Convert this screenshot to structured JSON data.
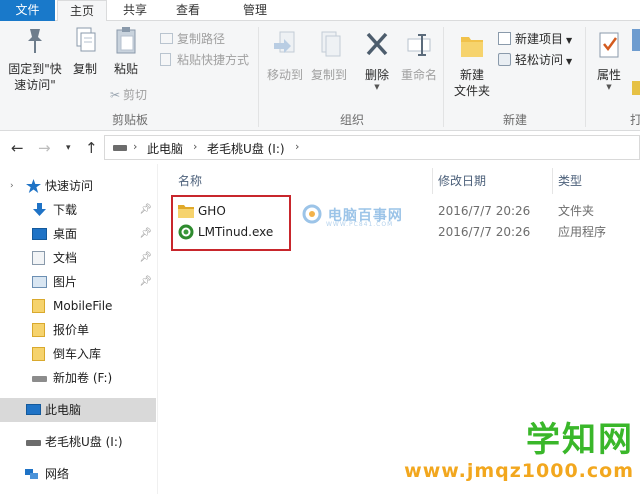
{
  "tabs": {
    "file": "文件",
    "home": "主页",
    "share": "共享",
    "view": "查看",
    "manage": "管理"
  },
  "ribbon": {
    "clipboard": {
      "pin_quick_access_line1": "固定到\"快",
      "pin_quick_access_line2": "速访问\"",
      "copy": "复制",
      "paste": "粘贴",
      "copy_path": "复制路径",
      "paste_shortcut": "粘贴快捷方式",
      "cut": "剪切",
      "group_label": "剪贴板"
    },
    "organize": {
      "move_to": "移动到",
      "copy_to": "复制到",
      "delete": "删除",
      "rename": "重命名",
      "group_label": "组织"
    },
    "new": {
      "new_folder_line1": "新建",
      "new_folder_line2": "文件夹",
      "new_item": "新建项目",
      "easy_access": "轻松访问",
      "group_label": "新建"
    },
    "open": {
      "properties": "属性",
      "group_label": "打"
    }
  },
  "address": {
    "crumbs": [
      "此电脑",
      "老毛桃U盘 (I:)"
    ]
  },
  "nav_pane": {
    "quick_access": "快速访问",
    "downloads": "下载",
    "desktop": "桌面",
    "documents": "文档",
    "pictures": "图片",
    "mobilefile": "MobileFile",
    "quote": "报价单",
    "parking": "倒车入库",
    "new_volume": "新加卷 (F:)",
    "this_pc": "此电脑",
    "usb_drive": "老毛桃U盘 (I:)",
    "network": "网络"
  },
  "columns": {
    "name": "名称",
    "modified": "修改日期",
    "type": "类型"
  },
  "files": [
    {
      "name": "GHO",
      "modified": "2016/7/7 20:26",
      "type": "文件夹",
      "icon": "folder-icon"
    },
    {
      "name": "LMTinud.exe",
      "modified": "2016/7/7 20:26",
      "type": "应用程序",
      "icon": "exe-app-icon"
    }
  ],
  "watermarks": {
    "pc841_text": "电脑百事网",
    "pc841_url": "WWW.PC841.COM",
    "site_title": "学知网",
    "site_url": "www.jmqz1000.com"
  },
  "colors": {
    "file_tab": "#1979ca",
    "highlight_border": "#c8262c",
    "watermark_green": "#3ab72a",
    "watermark_orange": "#f2a71e",
    "folder_yellow": "#f1c24b"
  }
}
